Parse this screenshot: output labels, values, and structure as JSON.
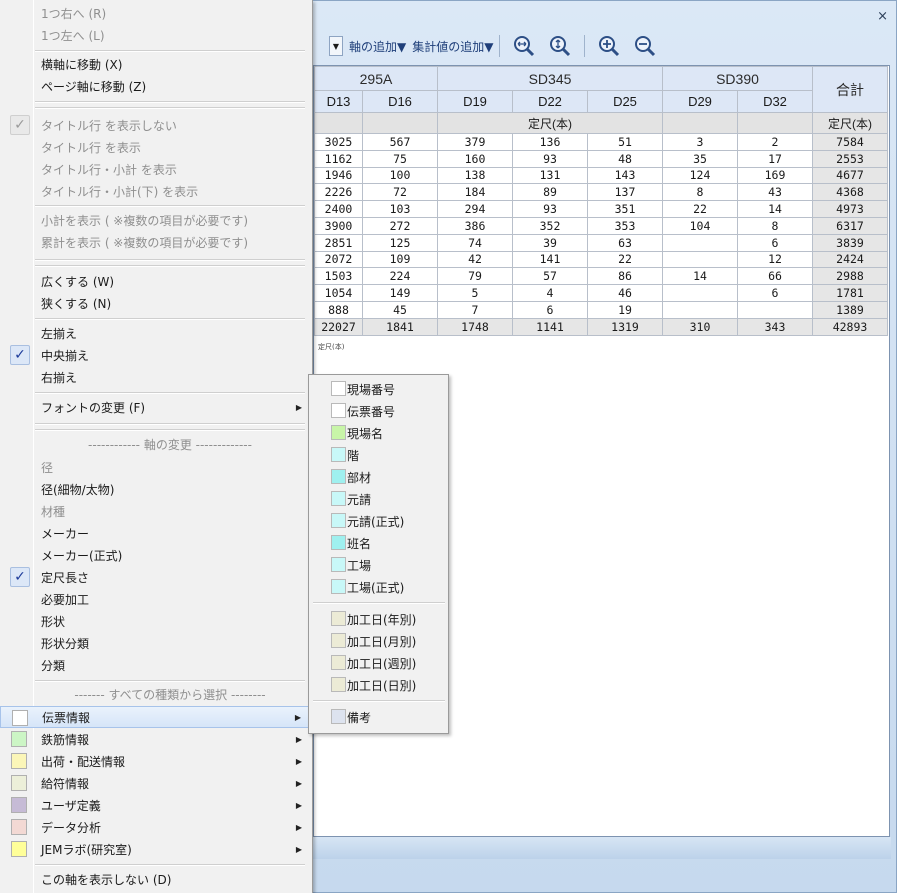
{
  "window": {
    "close_label": "×"
  },
  "toolbar": {
    "combo_arrow": "▼",
    "add_axis": "軸の追加▼",
    "add_aggregate": "集計値の追加▼",
    "icons": [
      "zoom-fit-width-icon",
      "zoom-fit-height-icon",
      "zoom-in-icon",
      "zoom-out-icon"
    ]
  },
  "grid": {
    "groups": [
      "295A",
      "SD345",
      "SD390"
    ],
    "total_label": "合計",
    "columns": [
      "D13",
      "D16",
      "D19",
      "D22",
      "D25",
      "D29",
      "D32"
    ],
    "sub_header": "定尺(本)",
    "total_sub_header": "定尺(本)",
    "rows": [
      [
        "3025",
        "567",
        "379",
        "136",
        "51",
        "3",
        "2",
        "7584"
      ],
      [
        "1162",
        "75",
        "160",
        "93",
        "48",
        "35",
        "17",
        "2553"
      ],
      [
        "1946",
        "100",
        "138",
        "131",
        "143",
        "124",
        "169",
        "4677"
      ],
      [
        "2226",
        "72",
        "184",
        "89",
        "137",
        "8",
        "43",
        "4368"
      ],
      [
        "2400",
        "103",
        "294",
        "93",
        "351",
        "22",
        "14",
        "4973"
      ],
      [
        "3900",
        "272",
        "386",
        "352",
        "353",
        "104",
        "8",
        "6317"
      ],
      [
        "2851",
        "125",
        "74",
        "39",
        "63",
        "",
        "6",
        "3839"
      ],
      [
        "2072",
        "109",
        "42",
        "141",
        "22",
        "",
        "12",
        "2424"
      ],
      [
        "1503",
        "224",
        "79",
        "57",
        "86",
        "14",
        "66",
        "2988"
      ],
      [
        "1054",
        "149",
        "5",
        "4",
        "46",
        "",
        "6",
        "1781"
      ],
      [
        "888",
        "45",
        "7",
        "6",
        "19",
        "",
        "",
        "1389"
      ]
    ],
    "totals": [
      "22027",
      "1841",
      "1748",
      "1141",
      "1319",
      "310",
      "343",
      "42893"
    ],
    "note": "定尺(本)"
  },
  "menu": {
    "move_right": "1つ右へ (R)",
    "move_left": "1つ左へ (L)",
    "to_horizontal": "横軸に移動 (X)",
    "to_page": "ページ軸に移動 (Z)",
    "hide_title_row": "タイトル行 を表示しない",
    "show_title_row": "タイトル行 を表示",
    "show_title_subtotal": "タイトル行・小計 を表示",
    "show_title_subtotal_bottom": "タイトル行・小計(下) を表示",
    "show_subtotal": "小計を表示 ( ※複数の項目が必要です)",
    "show_cumulative": "累計を表示 ( ※複数の項目が必要です)",
    "widen": "広くする (W)",
    "narrow": "狭くする (N)",
    "align_left": "左揃え",
    "align_center": "中央揃え",
    "align_right": "右揃え",
    "change_font": "フォントの変更 (F)",
    "axis_change_title": "------------ 軸の変更 -------------",
    "diameter": "径",
    "diameter_thin_thick": "径(細物/太物)",
    "material": "材種",
    "maker": "メーカー",
    "maker_formal": "メーカー(正式)",
    "fixed_length": "定尺長さ",
    "required_processing": "必要加工",
    "shape": "形状",
    "shape_category": "形状分類",
    "category": "分類",
    "select_all_title": "------- すべての種類から選択 --------",
    "slip_info": "伝票情報",
    "rebar_info": "鉄筋情報",
    "shipping_info": "出荷・配送情報",
    "supply_info": "給符情報",
    "user_defined": "ユーザ定義",
    "data_analysis": "データ分析",
    "jem_lab": "JEMラボ(研究室)",
    "hide_axis": "この軸を表示しない (D)",
    "check_mark": "✓",
    "submenu_arrow": "▶",
    "swatch_colors": {
      "slip_info": "#ffffff",
      "rebar_info": "#ccf5c5",
      "shipping_info": "#fbf6b8",
      "supply_info": "#ecefd9",
      "user_defined": "#c6bbd6",
      "data_analysis": "#f3d9d4",
      "jem_lab": "#ffff99"
    }
  },
  "submenu": {
    "site_number": "現場番号",
    "slip_number": "伝票番号",
    "site_name": "現場名",
    "floor": "階",
    "member": "部材",
    "prime_contractor": "元請",
    "prime_contractor_formal": "元請(正式)",
    "team_name": "班名",
    "factory": "工場",
    "factory_formal": "工場(正式)",
    "processing_date_year": "加工日(年別)",
    "processing_date_month": "加工日(月別)",
    "processing_date_week": "加工日(週別)",
    "processing_date_day": "加工日(日別)",
    "remarks": "備考",
    "swatch_colors": {
      "white": "#ffffff",
      "green": "#c8f5a8",
      "cyan": "#c8f8f8",
      "cyan_strong": "#9ff0ef",
      "beige": "#ecebd6",
      "lavender": "#dde3ef"
    }
  }
}
